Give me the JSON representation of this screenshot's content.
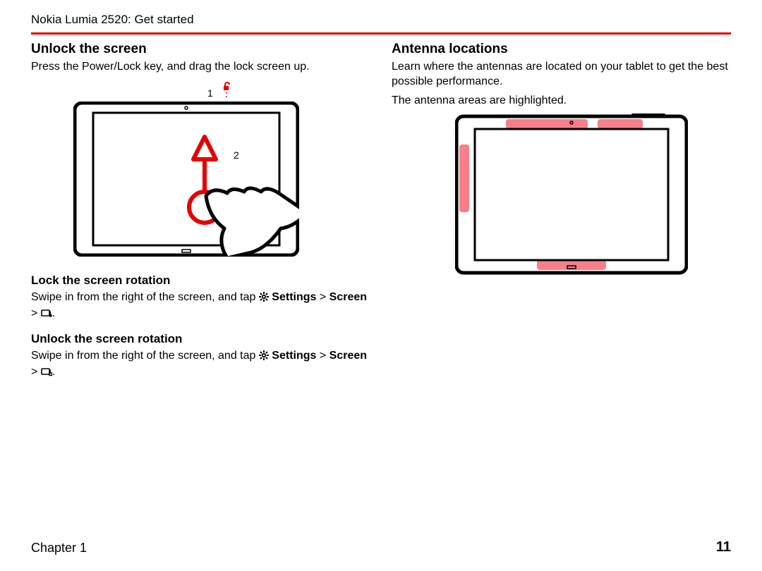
{
  "header": {
    "title": "Nokia Lumia 2520: Get started"
  },
  "left": {
    "h_unlock": "Unlock the screen",
    "p_unlock": "Press the Power/Lock key, and drag the lock screen up.",
    "label1": "1",
    "label2": "2",
    "h_lock_rot": "Lock the screen rotation",
    "p_rot_pre": "Swipe in from the right of the screen, and tap ",
    "settings_label": "Settings",
    "screen_label": "Screen",
    "gt": " > ",
    "h_unlock_rot": "Unlock the screen rotation"
  },
  "right": {
    "h_antenna": "Antenna locations",
    "p_antenna1": "Learn where the antennas are located on your tablet to get the best possible performance.",
    "p_antenna2": "The antenna areas are highlighted."
  },
  "footer": {
    "chapter": "Chapter 1",
    "page": "11"
  },
  "icons": {
    "gear": "gear-icon",
    "lock": "lock-icon",
    "rotation_lock": "rotation-lock-icon",
    "rotation_unlock": "rotation-unlock-icon"
  },
  "colors": {
    "accent": "#e60000",
    "highlight": "#f77f8a"
  }
}
